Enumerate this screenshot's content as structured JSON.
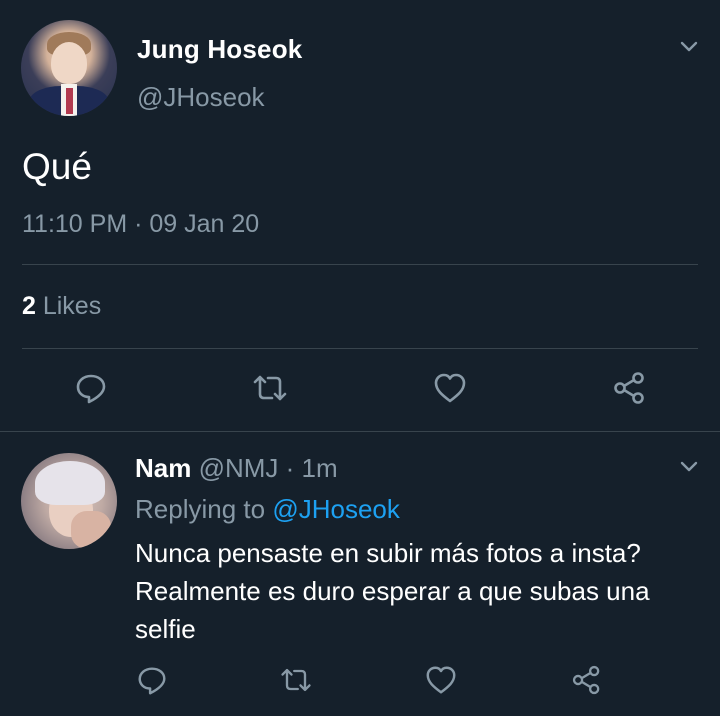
{
  "main_tweet": {
    "author": {
      "display_name": "Jung Hoseok",
      "handle": "@JHoseok"
    },
    "text": "Qué",
    "timestamp": "11:10 PM · 09 Jan 20",
    "likes": {
      "count": "2",
      "label": " Likes"
    },
    "actions": [
      "reply-icon",
      "retweet-icon",
      "like-icon",
      "share-icon"
    ]
  },
  "reply_tweet": {
    "author": {
      "display_name": "Nam",
      "handle": "@NMJ",
      "time_separator": " · ",
      "time": "1m"
    },
    "replying_to_label": "Replying to ",
    "replying_to_handle": "@JHoseok",
    "text_lines": [
      "Nunca pensaste en subir más fotos a insta?",
      "Realmente es duro esperar a que subas una",
      "selfie"
    ],
    "actions": [
      "reply-icon",
      "retweet-icon",
      "like-icon",
      "share-icon"
    ]
  },
  "colors": {
    "background": "#15202b",
    "primary_text": "#ffffff",
    "secondary_text": "#8899a6",
    "divider": "#38444d",
    "link": "#1da1f2"
  }
}
